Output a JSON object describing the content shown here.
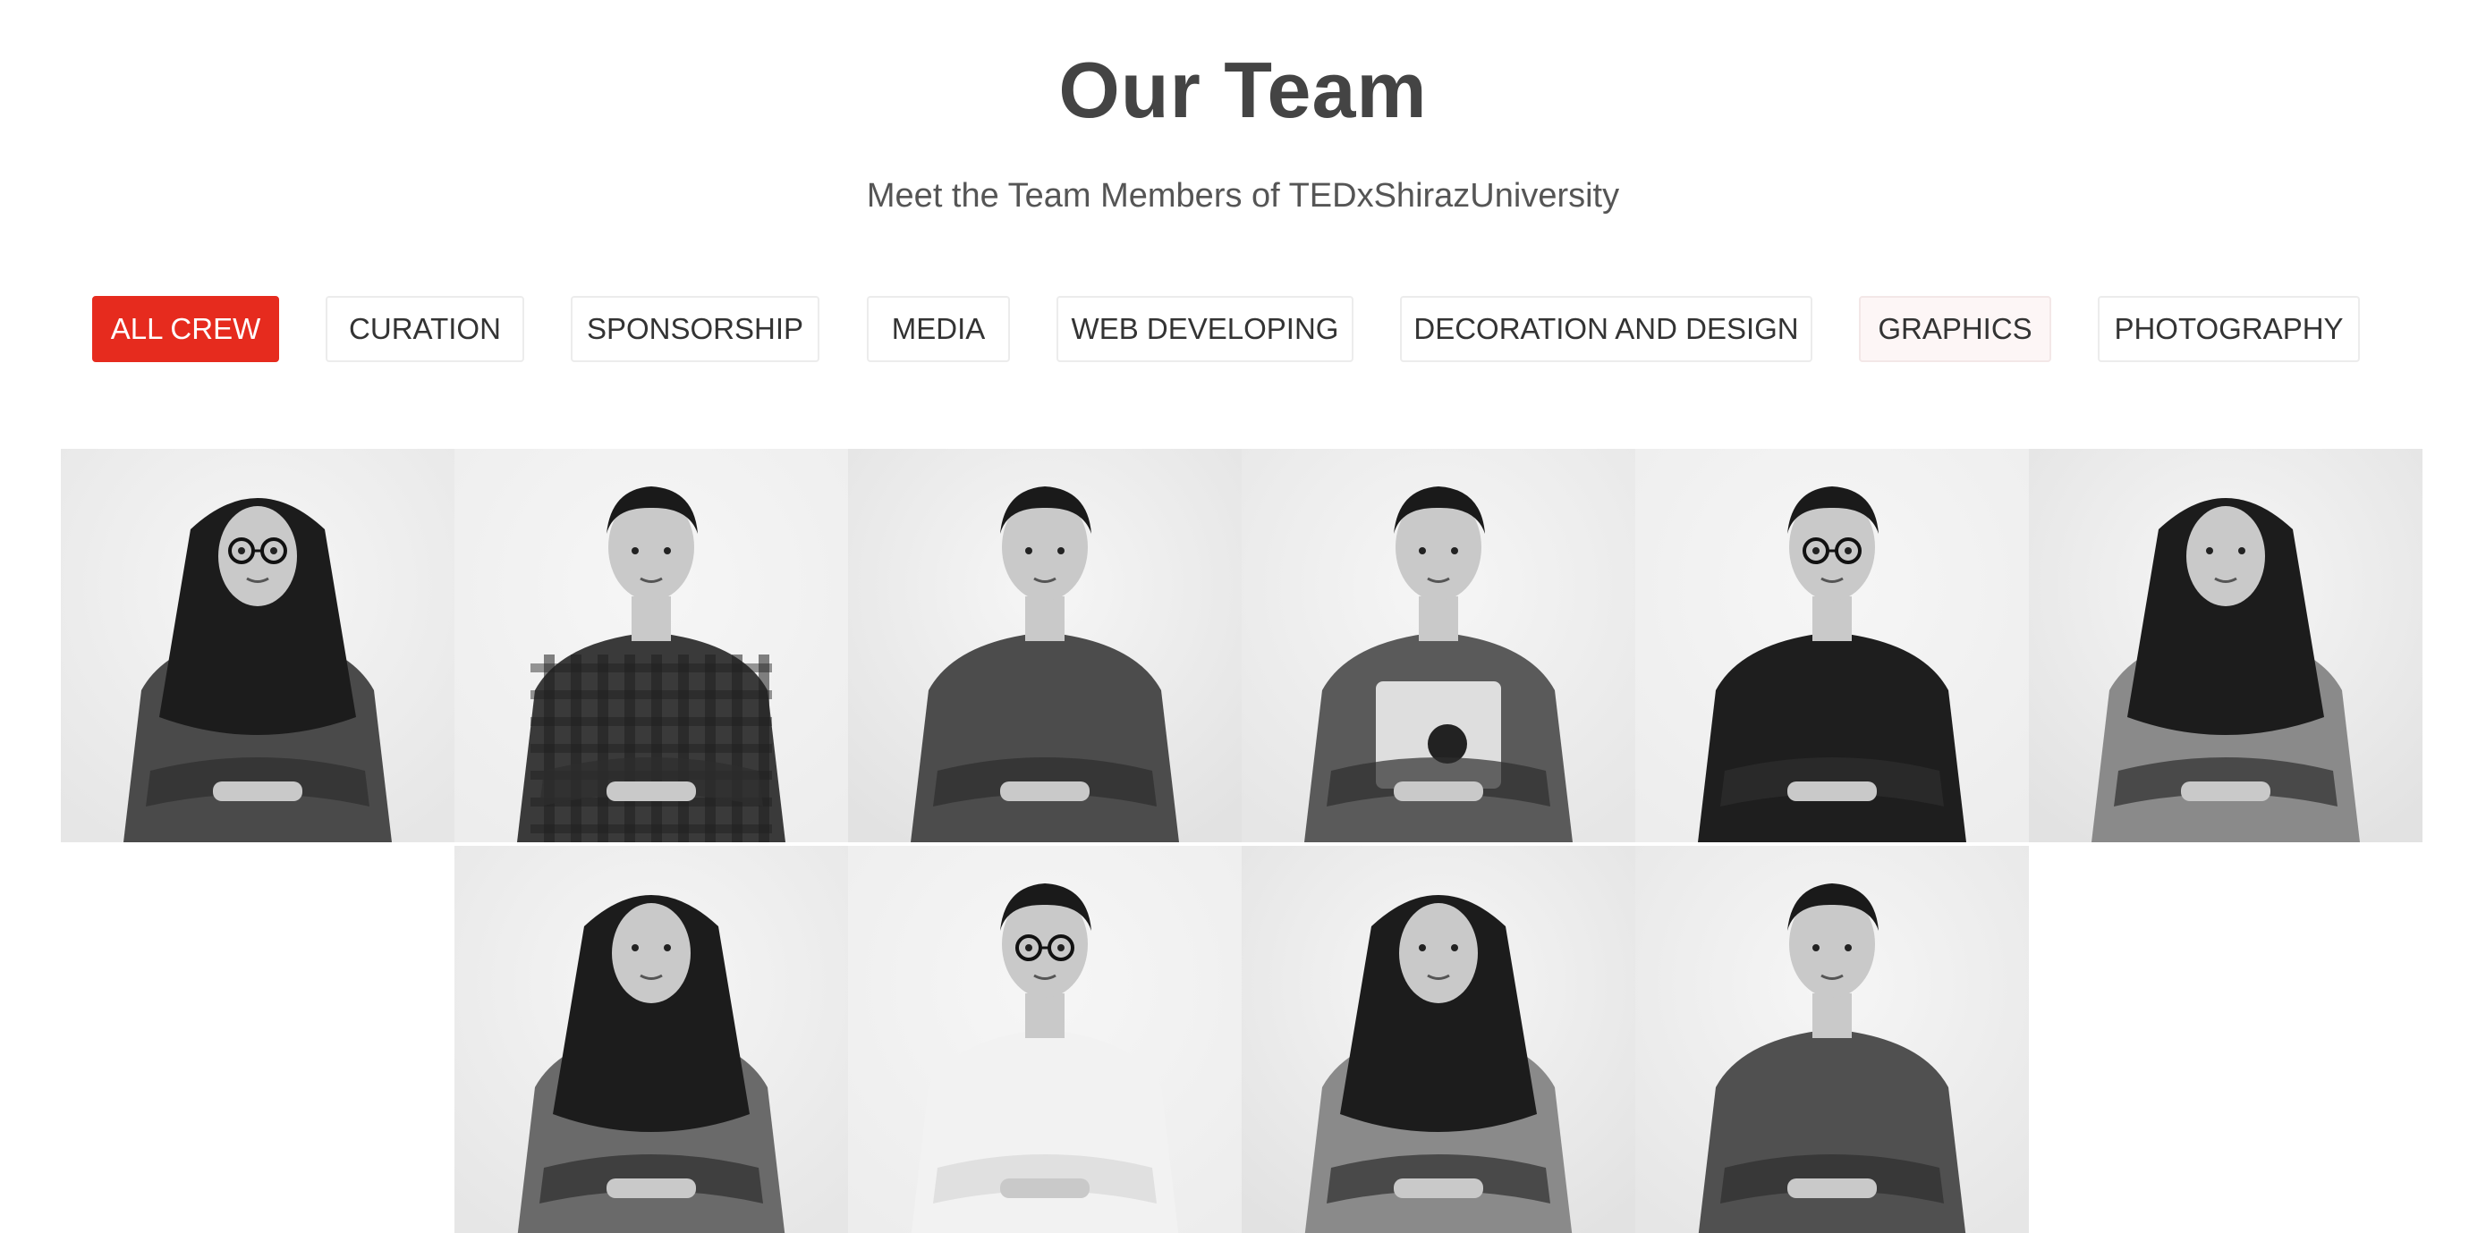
{
  "header": {
    "title": "Our Team",
    "subtitle": "Meet the Team Members of TEDxShirazUniversity"
  },
  "filters": [
    {
      "label": "ALL CREW",
      "state": "active"
    },
    {
      "label": "CURATION",
      "state": "default"
    },
    {
      "label": "SPONSORSHIP",
      "state": "default"
    },
    {
      "label": "MEDIA",
      "state": "default"
    },
    {
      "label": "WEB DEVELOPING",
      "state": "default"
    },
    {
      "label": "DECORATION AND DESIGN",
      "state": "default"
    },
    {
      "label": "GRAPHICS",
      "state": "hover"
    },
    {
      "label": "PHOTOGRAPHY",
      "state": "default"
    }
  ],
  "colors": {
    "accent": "#e62b1e",
    "title_text": "#444444",
    "subtitle_text": "#555555",
    "button_border": "#ececec"
  },
  "team_photos": [
    {
      "row": 1,
      "col": 1,
      "hijab": true,
      "shirt": "patterned",
      "glasses": true
    },
    {
      "row": 1,
      "col": 2,
      "hijab": false,
      "shirt": "plaid",
      "glasses": false
    },
    {
      "row": 1,
      "col": 3,
      "hijab": false,
      "shirt": "dark-button",
      "glasses": false
    },
    {
      "row": 1,
      "col": 4,
      "hijab": false,
      "shirt": "graphic-tee",
      "glasses": false
    },
    {
      "row": 1,
      "col": 5,
      "hijab": false,
      "shirt": "black-tee",
      "glasses": true
    },
    {
      "row": 1,
      "col": 6,
      "hijab": true,
      "shirt": "light",
      "glasses": false
    },
    {
      "row": 2,
      "col": 2,
      "hijab": true,
      "shirt": "gray",
      "glasses": false
    },
    {
      "row": 2,
      "col": 3,
      "hijab": false,
      "shirt": "white-polo",
      "glasses": true
    },
    {
      "row": 2,
      "col": 4,
      "hijab": true,
      "shirt": "light",
      "glasses": false
    },
    {
      "row": 2,
      "col": 5,
      "hijab": false,
      "shirt": "dark-polo",
      "glasses": false
    }
  ]
}
